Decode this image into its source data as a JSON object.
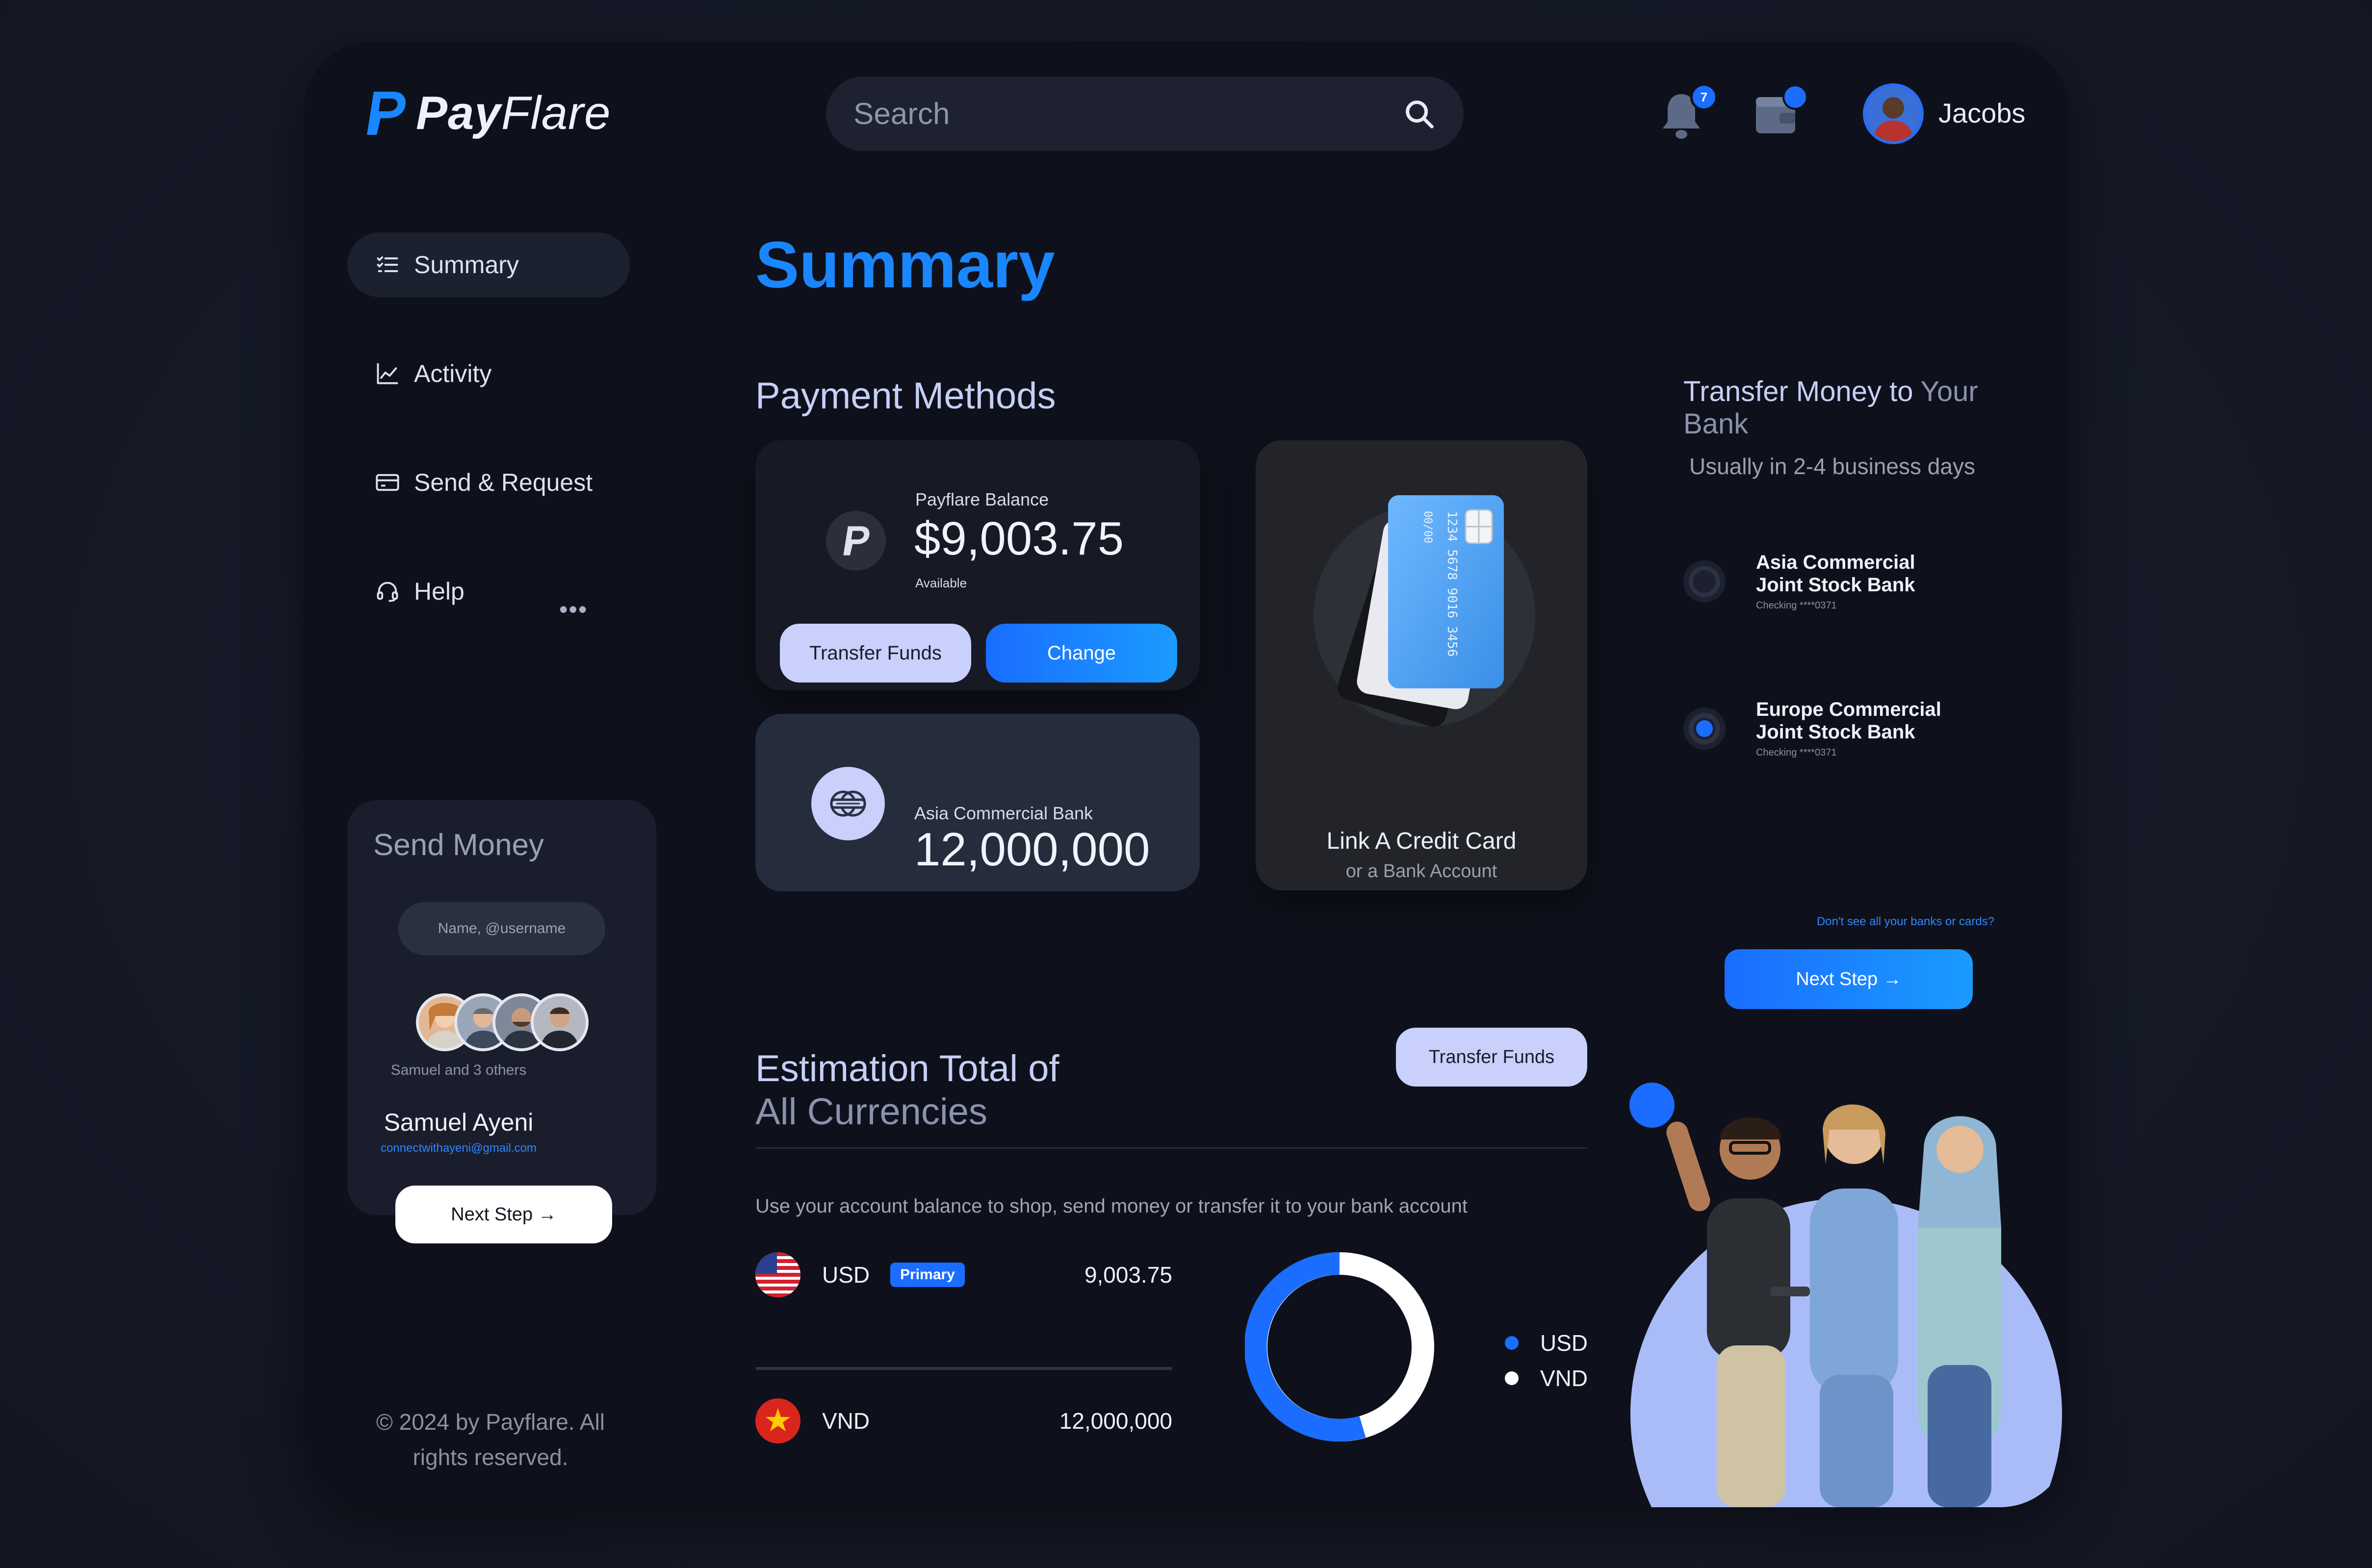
{
  "app": {
    "brand_bold": "Pay",
    "brand_light": "Flare"
  },
  "header": {
    "search_placeholder": "Search",
    "notification_count": "7",
    "user_name": "Jacobs"
  },
  "sidebar": {
    "items": [
      {
        "label": "Summary",
        "icon": "list-icon",
        "active": true
      },
      {
        "label": "Activity",
        "icon": "chart-line-icon",
        "active": false
      },
      {
        "label": "Send & Request",
        "icon": "card-icon",
        "active": false
      },
      {
        "label": "Help",
        "icon": "headset-icon",
        "active": false
      }
    ],
    "more_label": "•••",
    "send_money": {
      "title": "Send Money",
      "input_placeholder": "Name, @username",
      "recipients_note": "Samuel and 3 others",
      "recipient_name": "Samuel Ayeni",
      "recipient_email": "connectwithayeni@gmail.com",
      "next_label": "Next Step →"
    },
    "copyright_line1": "© 2024 by Payflare. All",
    "copyright_line2": "rights reserved."
  },
  "main": {
    "title": "Summary",
    "payment_methods_title": "Payment Methods",
    "balance_card": {
      "label": "Payflare Balance",
      "amount": "$9,003.75",
      "sub": "Available",
      "transfer_label": "Transfer Funds",
      "change_label": "Change"
    },
    "bank_card": {
      "label": "Asia Commercial Bank",
      "amount": "12,000,000"
    },
    "link_card": {
      "title": "Link A Credit Card",
      "subtitle": "or a Bank Account",
      "card_number": "1234 5678 9016 3456",
      "card_expiry": "00/00"
    },
    "estimation": {
      "title_line1": "Estimation Total of",
      "title_line2": "All Currencies",
      "button_label": "Transfer Funds",
      "description": "Use your account balance to shop, send money or transfer it to your bank account",
      "rows": [
        {
          "code": "USD",
          "badge": "Primary",
          "amount": "9,003.75"
        },
        {
          "code": "VND",
          "badge": "",
          "amount": "12,000,000"
        }
      ],
      "legend": [
        {
          "label": "USD",
          "color": "#1a6dff"
        },
        {
          "label": "VND",
          "color": "#ffffff"
        }
      ]
    }
  },
  "transfer": {
    "title_main": "Transfer Money to ",
    "title_dim": "Your Bank",
    "subtitle": "Usually in 2-4 business days",
    "banks": [
      {
        "name_line1": "Asia Commercial",
        "name_line2": "Joint Stock Bank",
        "account": "Checking ****0371",
        "selected": false
      },
      {
        "name_line1": "Europe Commercial",
        "name_line2": "Joint Stock Bank",
        "account": "Checking ****0371",
        "selected": true
      }
    ],
    "dont_see": "Don't see all your banks or cards?",
    "next_label": "Next Step →"
  },
  "colors": {
    "accent": "#1a6dff",
    "accent_light": "#c8d0fb",
    "background": "#0e111b"
  }
}
